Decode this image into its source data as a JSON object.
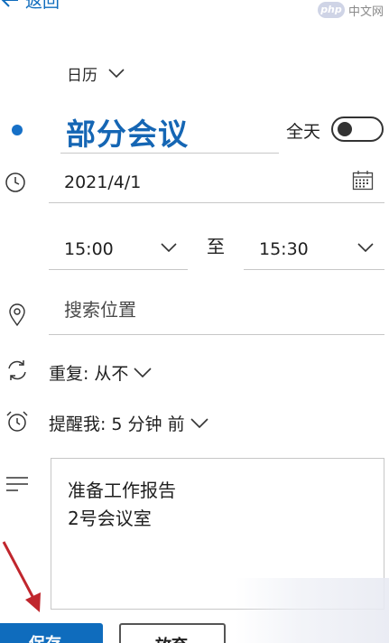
{
  "header": {
    "back_label": "返回",
    "watermark_badge": "php",
    "watermark_text": "中文网"
  },
  "event": {
    "calendar": "日历",
    "title": "部分会议",
    "all_day_label": "全天",
    "all_day": false,
    "date": "2021/4/1",
    "start_time": "15:00",
    "to_label": "至",
    "end_time": "15:30",
    "location_placeholder": "搜索位置",
    "repeat_label": "重复:",
    "repeat_value": "从不",
    "reminder_label": "提醒我:",
    "reminder_value": "5 分钟 前",
    "notes": [
      "准备工作报告",
      "2号会议室"
    ]
  },
  "actions": {
    "save_label": "保存",
    "discard_label": "放弃"
  },
  "colors": {
    "accent": "#0f6cbd",
    "title": "#1566b4",
    "annotation_arrow": "#c0262d"
  }
}
